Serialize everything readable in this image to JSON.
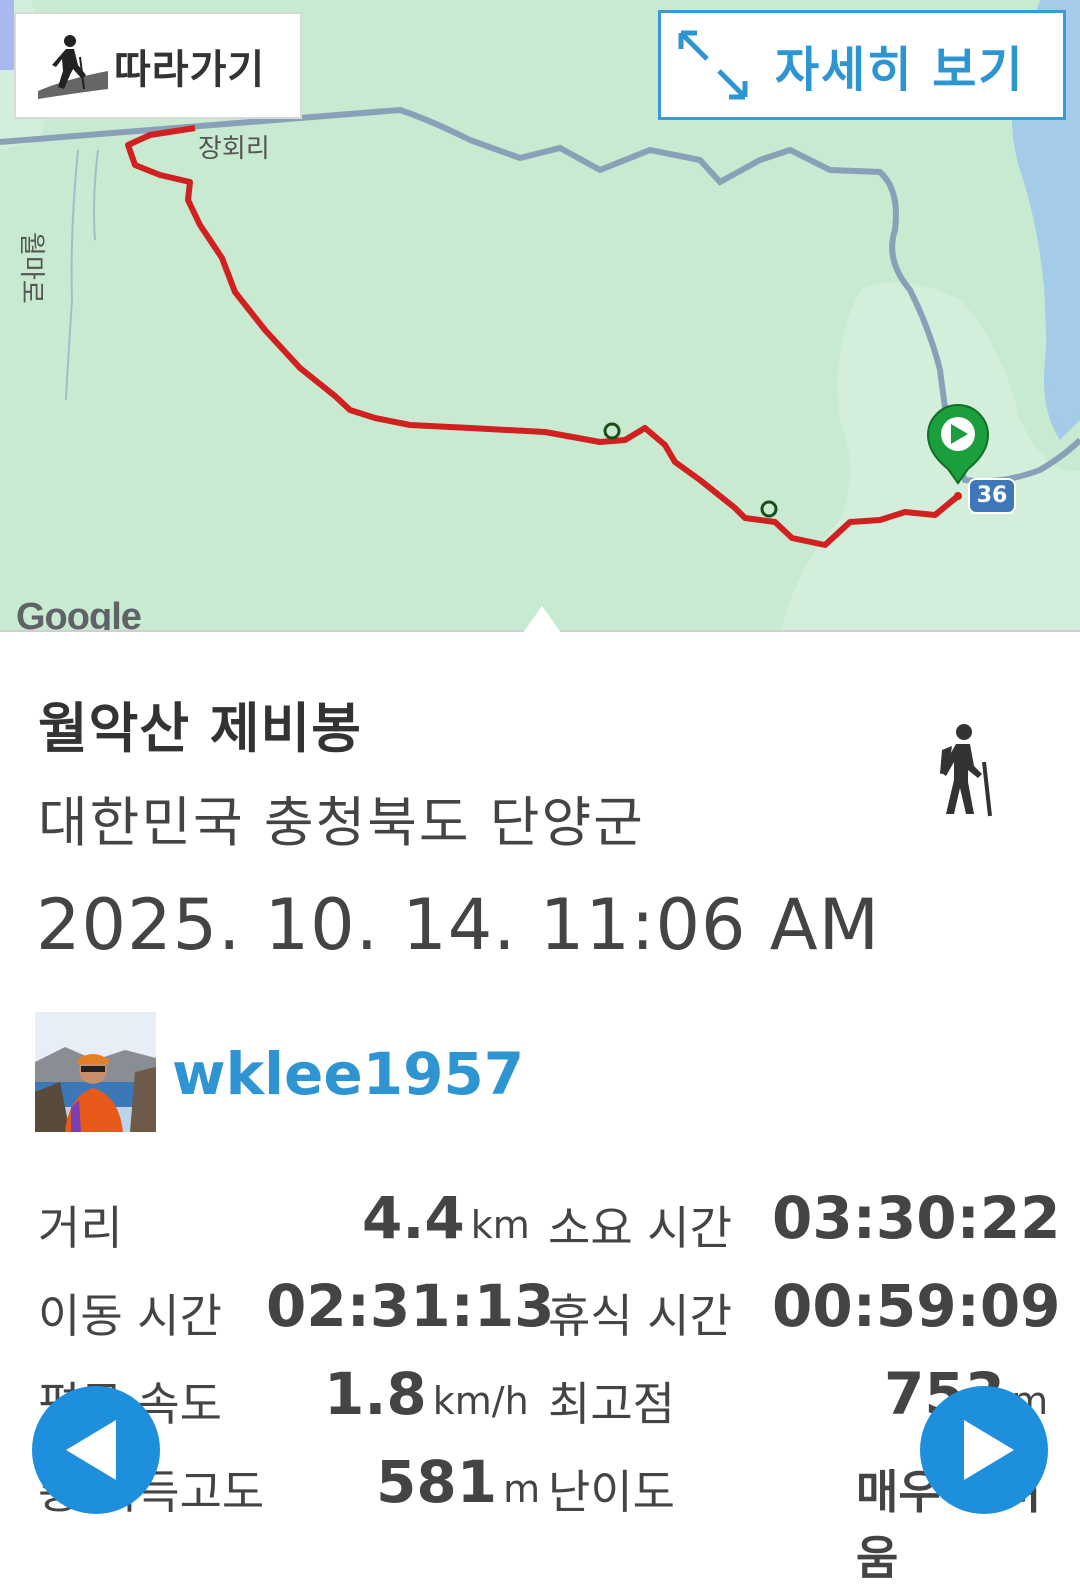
{
  "map": {
    "follow_label": "따라가기",
    "detail_label": "자세히 보기",
    "place_label_1": "장회리",
    "place_label_2": "월마로",
    "route_number": "36",
    "google_text": "Google",
    "colors": {
      "land": "#c7ead1",
      "water": "#a4cbe8",
      "road": "#8aa0b8",
      "track": "#d21f1f",
      "start_marker": "#1a9f3c"
    },
    "icons": [
      "hiker-follow-icon",
      "expand-arrows-icon",
      "start-marker-icon",
      "waypoint-icon"
    ]
  },
  "track": {
    "title": "월악산 제비봉",
    "location": "대한민국 충청북도 단양군",
    "datetime": "2025. 10. 14. 11:06 AM",
    "activity_icon": "hiking-icon",
    "username": "wklee1957"
  },
  "stats": {
    "distance_label": "거리",
    "distance_value": "4.4",
    "distance_unit": "km",
    "duration_label": "소요 시간",
    "duration_value": "03:30:22",
    "moving_label": "이동 시간",
    "moving_value": "02:31:13",
    "rest_label": "휴식 시간",
    "rest_value": "00:59:09",
    "avg_speed_label": "평균 속도",
    "avg_speed_value": "1.8",
    "avg_speed_unit": "km/h",
    "max_alt_label": "최고점",
    "max_alt_value": "753",
    "max_alt_unit": "m",
    "gain_label": "총 획득고도",
    "gain_value": "581",
    "gain_unit": "m",
    "difficulty_label": "난이도",
    "difficulty_value": "매우 어려움"
  },
  "nav": {
    "prev_icon": "prev-arrow-icon",
    "next_icon": "next-arrow-icon"
  }
}
